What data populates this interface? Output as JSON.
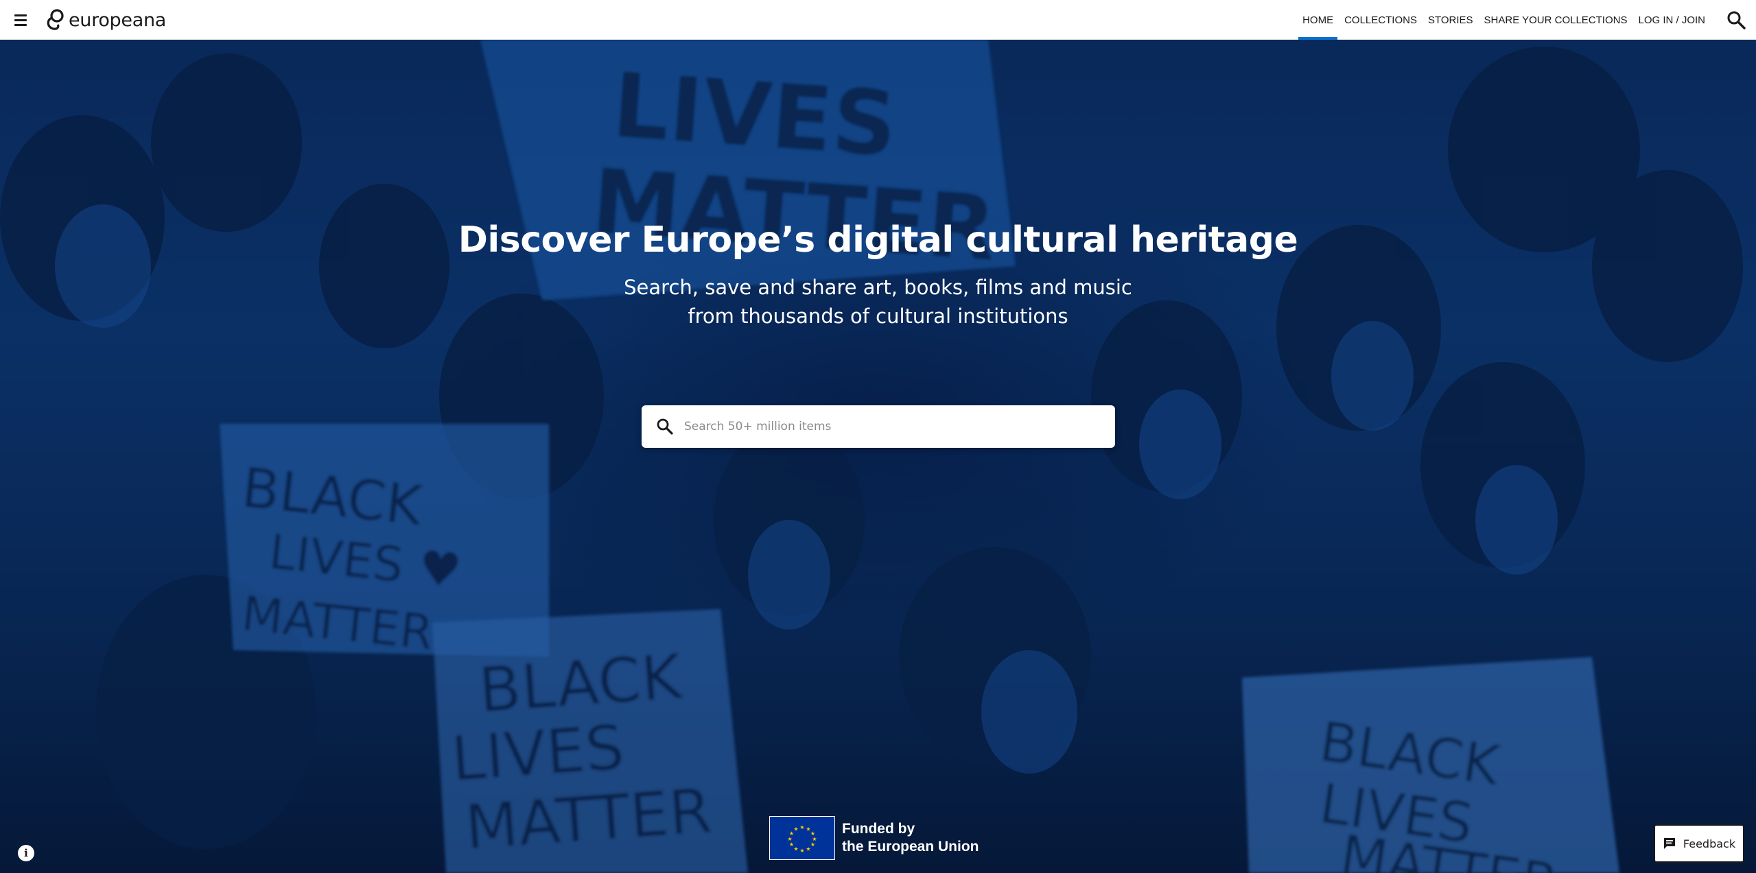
{
  "header": {
    "logo_text": "europeana",
    "nav": [
      {
        "label": "HOME",
        "active": true
      },
      {
        "label": "COLLECTIONS",
        "active": false
      },
      {
        "label": "STORIES",
        "active": false
      },
      {
        "label": "SHARE YOUR COLLECTIONS",
        "active": false
      },
      {
        "label": "LOG IN / JOIN",
        "active": false
      }
    ],
    "icons": [
      "menu-icon",
      "search-icon"
    ]
  },
  "hero": {
    "title": "Discover Europe’s digital cultural heritage",
    "subtitle_line1": "Search, save and share art, books, films and music",
    "subtitle_line2": "from thousands of cultural institutions",
    "search": {
      "placeholder": "Search 50+ million items",
      "value": ""
    },
    "background_signs": [
      "BLACK LIVES MATTER",
      "BLACK LIVES MATTER",
      "BLACK LIVES MATTER",
      "BLACK LIVES MATTER",
      "LIVES MATTER"
    ]
  },
  "funding": {
    "line1": "Funded by",
    "line2": "the European Union"
  },
  "feedback": {
    "label": "Feedback"
  },
  "colors": {
    "accent": "#0a72cc",
    "hero_tint": "#0d3a78",
    "eu_blue": "#003399",
    "eu_star": "#ffcc00"
  }
}
